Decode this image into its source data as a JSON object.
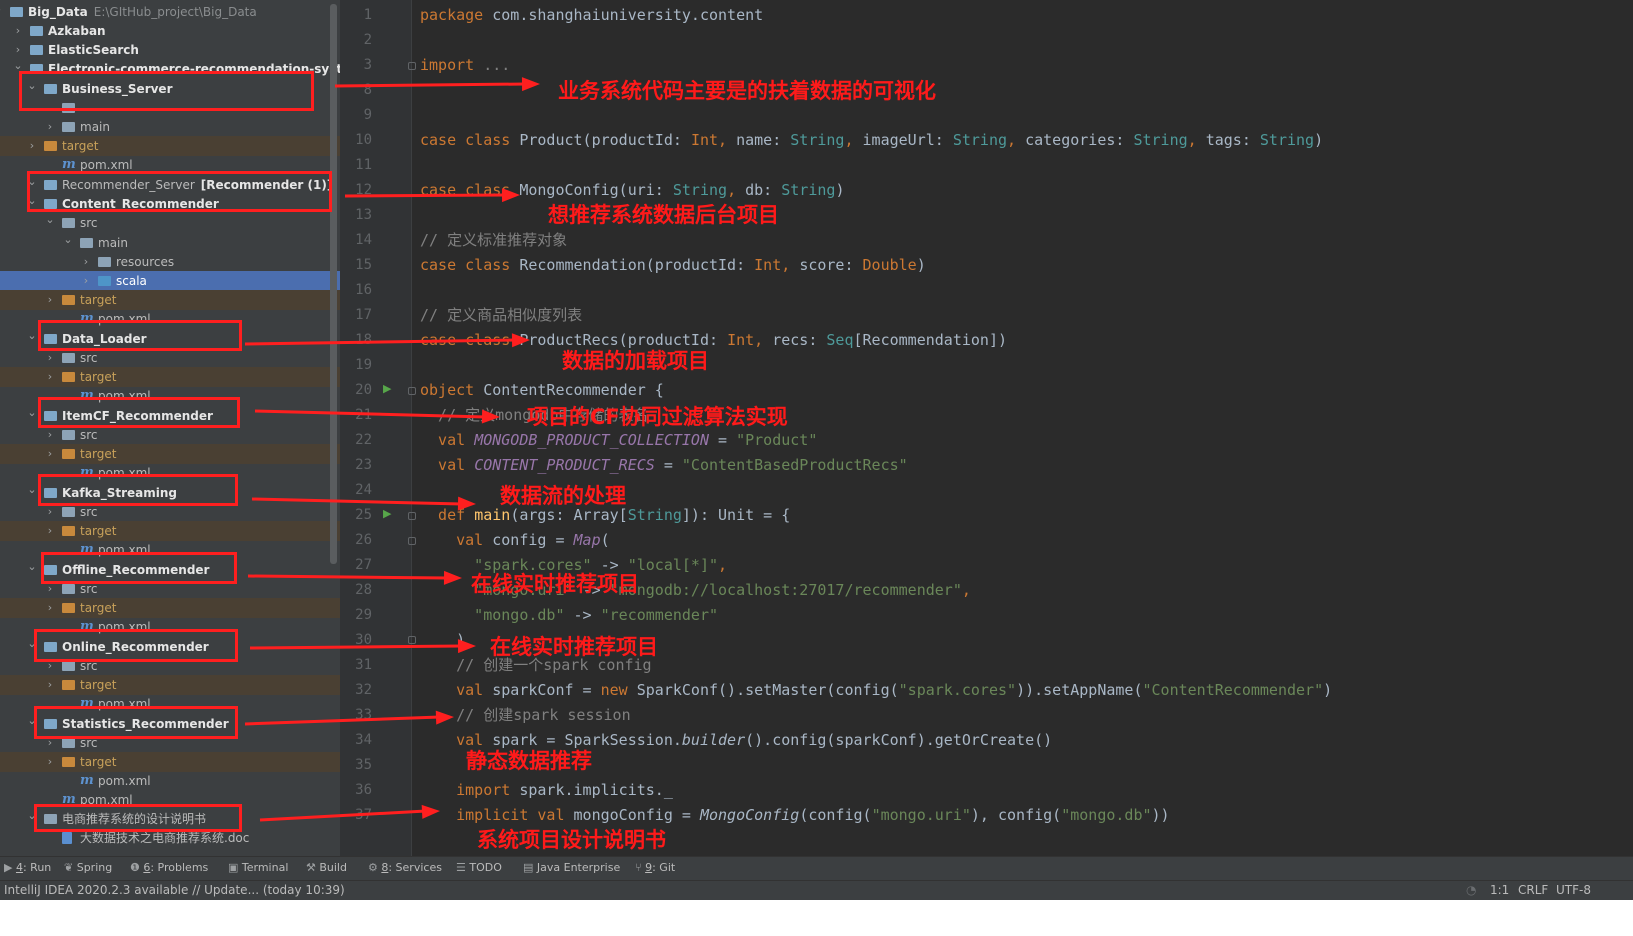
{
  "project_tree": {
    "rows": [
      {
        "label": "Big_Data",
        "path": "E:\\GItHub_project\\Big_Data",
        "bold": true,
        "chev": "v",
        "icon": "mod"
      },
      {
        "label": "Azkaban",
        "bold": true,
        "chev": ">",
        "icon": "mod"
      },
      {
        "label": "ElasticSearch",
        "bold": true,
        "chev": ">",
        "icon": "mod"
      },
      {
        "label": "Electronic-commerce-recommendation-system",
        "bold": true,
        "chev": "v",
        "icon": "mod"
      },
      {
        "label": "Business_Server",
        "bold": true,
        "chev": "v",
        "icon": "mod"
      },
      {
        "label": "",
        "chev": "",
        "icon": "fold"
      },
      {
        "label": "main",
        "chev": ">",
        "icon": "fold"
      },
      {
        "label": "target",
        "chev": ">",
        "icon": "ofold",
        "target": true
      },
      {
        "label": "pom.xml",
        "chev": "",
        "icon": "mv"
      },
      {
        "label": "Recommender_Server",
        "path": "[Recommender (1)]",
        "chev": "v",
        "icon": "mod"
      },
      {
        "label": "Content_Recommender",
        "bold": true,
        "chev": "v",
        "icon": "mod"
      },
      {
        "label": "src",
        "chev": "v",
        "icon": "fold"
      },
      {
        "label": "main",
        "chev": "v",
        "icon": "fold"
      },
      {
        "label": "resources",
        "chev": ">",
        "icon": "fold"
      },
      {
        "label": "scala",
        "chev": ">",
        "icon": "bfold",
        "selected": true
      },
      {
        "label": "target",
        "chev": ">",
        "icon": "ofold",
        "target": true
      },
      {
        "label": "pom.xml",
        "chev": "",
        "icon": "mv"
      },
      {
        "label": "Data_Loader",
        "bold": true,
        "chev": "v",
        "icon": "mod"
      },
      {
        "label": "src",
        "chev": ">",
        "icon": "fold"
      },
      {
        "label": "target",
        "chev": ">",
        "icon": "ofold",
        "target": true
      },
      {
        "label": "pom.xml",
        "chev": "",
        "icon": "mv"
      },
      {
        "label": "ItemCF_Recommender",
        "bold": true,
        "chev": "v",
        "icon": "mod"
      },
      {
        "label": "src",
        "chev": ">",
        "icon": "fold"
      },
      {
        "label": "target",
        "chev": ">",
        "icon": "ofold",
        "target": true
      },
      {
        "label": "pom.xml",
        "chev": "",
        "icon": "mv"
      },
      {
        "label": "Kafka_Streaming",
        "bold": true,
        "chev": "v",
        "icon": "mod"
      },
      {
        "label": "src",
        "chev": ">",
        "icon": "fold"
      },
      {
        "label": "target",
        "chev": ">",
        "icon": "ofold",
        "target": true
      },
      {
        "label": "pom.xml",
        "chev": "",
        "icon": "mv"
      },
      {
        "label": "Offline_Recommender",
        "bold": true,
        "chev": "v",
        "icon": "mod"
      },
      {
        "label": "src",
        "chev": ">",
        "icon": "fold"
      },
      {
        "label": "target",
        "chev": ">",
        "icon": "ofold",
        "target": true
      },
      {
        "label": "pom.xml",
        "chev": "",
        "icon": "mv"
      },
      {
        "label": "Online_Recommender",
        "bold": true,
        "chev": "v",
        "icon": "mod"
      },
      {
        "label": "src",
        "chev": ">",
        "icon": "fold"
      },
      {
        "label": "target",
        "chev": ">",
        "icon": "ofold",
        "target": true
      },
      {
        "label": "pom.xml",
        "chev": "",
        "icon": "mv"
      },
      {
        "label": "Statistics_Recommender",
        "bold": true,
        "chev": "v",
        "icon": "mod"
      },
      {
        "label": "src",
        "chev": ">",
        "icon": "fold"
      },
      {
        "label": "target",
        "chev": ">",
        "icon": "ofold",
        "target": true
      },
      {
        "label": "pom.xml",
        "chev": "",
        "icon": "mv"
      },
      {
        "label": "pom.xml",
        "chev": "",
        "icon": "mv"
      },
      {
        "label": "电商推荐系统的设计说明书",
        "chev": "v",
        "icon": "fold"
      },
      {
        "label": "大数据技术之电商推荐系统.doc",
        "chev": "",
        "icon": "doc"
      }
    ]
  },
  "editor": {
    "lines": [
      {
        "n": "1",
        "segs": [
          [
            "kw",
            "package "
          ],
          [
            "",
            "com.shanghaiuniversity.content"
          ]
        ]
      },
      {
        "n": "2",
        "segs": []
      },
      {
        "n": "3",
        "segs": [
          [
            "kw",
            "import "
          ],
          [
            "cm",
            "..."
          ]
        ]
      },
      {
        "n": "8",
        "segs": []
      },
      {
        "n": "9",
        "segs": []
      },
      {
        "n": "10",
        "segs": [
          [
            "kw",
            "case class "
          ],
          [
            "",
            "Product(productId: "
          ],
          [
            "kw",
            "Int, "
          ],
          [
            "",
            "name: "
          ],
          [
            "ty",
            "String"
          ],
          [
            "kw",
            ", "
          ],
          [
            "",
            "imageUrl: "
          ],
          [
            "ty",
            "String"
          ],
          [
            "kw",
            ", "
          ],
          [
            "",
            "categories: "
          ],
          [
            "ty",
            "String"
          ],
          [
            "kw",
            ", "
          ],
          [
            "",
            "tags: "
          ],
          [
            "ty",
            "String"
          ],
          [
            "",
            ")"
          ]
        ]
      },
      {
        "n": "11",
        "segs": []
      },
      {
        "n": "12",
        "segs": [
          [
            "kw",
            "case class "
          ],
          [
            "",
            "MongoConfig(uri: "
          ],
          [
            "ty",
            "String"
          ],
          [
            "kw",
            ", "
          ],
          [
            "",
            "db: "
          ],
          [
            "ty",
            "String"
          ],
          [
            "",
            ")"
          ]
        ]
      },
      {
        "n": "13",
        "segs": []
      },
      {
        "n": "14",
        "segs": [
          [
            "cm",
            "// 定义标准推荐对象"
          ]
        ]
      },
      {
        "n": "15",
        "segs": [
          [
            "kw",
            "case class "
          ],
          [
            "",
            "Recommendation(productId: "
          ],
          [
            "kw",
            "Int, "
          ],
          [
            "",
            "score: "
          ],
          [
            "kw",
            "Double"
          ],
          [
            "",
            ")"
          ]
        ]
      },
      {
        "n": "16",
        "segs": []
      },
      {
        "n": "17",
        "segs": [
          [
            "cm",
            "// 定义商品相似度列表"
          ]
        ]
      },
      {
        "n": "18",
        "segs": [
          [
            "kw",
            "case class "
          ],
          [
            "",
            "ProductRecs(productId: "
          ],
          [
            "kw",
            "Int, "
          ],
          [
            "",
            "recs: "
          ],
          [
            "ty",
            "Seq"
          ],
          [
            "",
            "[Recommendation])"
          ]
        ]
      },
      {
        "n": "19",
        "segs": []
      },
      {
        "n": "20",
        "segs": [
          [
            "kw",
            "object "
          ],
          [
            "",
            "ContentRecommender {"
          ]
        ]
      },
      {
        "n": "21",
        "segs": [
          [
            "cm",
            "  // 定义mongodb中存储的表名"
          ]
        ]
      },
      {
        "n": "22",
        "segs": [
          [
            "kw",
            "  val "
          ],
          [
            "it",
            "MONGODB_PRODUCT_COLLECTION"
          ],
          [
            "",
            " = "
          ],
          [
            "st",
            "\"Product\""
          ]
        ]
      },
      {
        "n": "23",
        "segs": [
          [
            "kw",
            "  val "
          ],
          [
            "it",
            "CONTENT_PRODUCT_RECS"
          ],
          [
            "",
            " = "
          ],
          [
            "st",
            "\"ContentBasedProductRecs\""
          ]
        ]
      },
      {
        "n": "24",
        "segs": []
      },
      {
        "n": "25",
        "segs": [
          [
            "kw",
            "  def "
          ],
          [
            "fn",
            "main"
          ],
          [
            "",
            "(args: Array["
          ],
          [
            "ty",
            "String"
          ],
          [
            "",
            "]): Unit = {"
          ]
        ]
      },
      {
        "n": "26",
        "segs": [
          [
            "kw",
            "    val "
          ],
          [
            "",
            "config = "
          ],
          [
            "it",
            "Map"
          ],
          [
            "",
            "("
          ]
        ]
      },
      {
        "n": "27",
        "segs": [
          [
            "st",
            "      \"spark.cores\""
          ],
          [
            "",
            " -> "
          ],
          [
            "st",
            "\"local[*]\""
          ],
          [
            "kw",
            ","
          ]
        ]
      },
      {
        "n": "28",
        "segs": [
          [
            "st",
            "      \"mongo.uri\""
          ],
          [
            "",
            " -> "
          ],
          [
            "st",
            "\"mongodb://localhost:27017/recommender\""
          ],
          [
            "kw",
            ","
          ]
        ]
      },
      {
        "n": "29",
        "segs": [
          [
            "st",
            "      \"mongo.db\""
          ],
          [
            "",
            " -> "
          ],
          [
            "st",
            "\"recommender\""
          ]
        ]
      },
      {
        "n": "30",
        "segs": [
          [
            "",
            "    )"
          ]
        ]
      },
      {
        "n": "31",
        "segs": [
          [
            "cm",
            "    // 创建一个spark config"
          ]
        ]
      },
      {
        "n": "32",
        "segs": [
          [
            "kw",
            "    val "
          ],
          [
            "",
            "sparkConf = "
          ],
          [
            "kw",
            "new "
          ],
          [
            "",
            "SparkConf().setMaster(config("
          ],
          [
            "st",
            "\"spark.cores\""
          ],
          [
            "",
            ")).setAppName("
          ],
          [
            "st",
            "\"ContentRecommender\""
          ],
          [
            "",
            ")"
          ]
        ]
      },
      {
        "n": "33",
        "segs": [
          [
            "cm",
            "    // 创建spark session"
          ]
        ]
      },
      {
        "n": "34",
        "segs": [
          [
            "kw",
            "    val "
          ],
          [
            "",
            "spark = SparkSession."
          ],
          [
            "itf",
            "builder"
          ],
          [
            "",
            "().config(sparkConf).getOrCreate()"
          ]
        ]
      },
      {
        "n": "35",
        "segs": []
      },
      {
        "n": "36",
        "segs": [
          [
            "kw",
            "    import "
          ],
          [
            "",
            "spark.implicits._"
          ]
        ]
      },
      {
        "n": "37",
        "segs": [
          [
            "kw",
            "    implicit val "
          ],
          [
            "",
            "mongoConfig = "
          ],
          [
            "itf",
            "MongoConfig"
          ],
          [
            "",
            "(config("
          ],
          [
            "st",
            "\"mongo.uri\""
          ],
          [
            "",
            "), config("
          ],
          [
            "st",
            "\"mongo.db\""
          ],
          [
            "",
            "))"
          ]
        ]
      }
    ]
  },
  "annotations": [
    "业务系统代码主要是的扶着数据的可视化",
    "想推荐系统数据后台项目",
    "数据的加载项目",
    "项目的CF协同过滤算法实现",
    "数据流的处理",
    "在线实时推荐项目",
    "在线实时推荐项目",
    "静态数据推荐",
    "系统项目设计说明书"
  ],
  "bottom_tabs": [
    {
      "num": "4",
      "label": ": Run",
      "icon": "run-icon"
    },
    {
      "num": "",
      "label": "Spring",
      "icon": "spring-icon"
    },
    {
      "num": "6",
      "label": ": Problems",
      "icon": "problems-icon"
    },
    {
      "num": "",
      "label": "Terminal",
      "icon": "terminal-icon"
    },
    {
      "num": "",
      "label": "Build",
      "icon": "build-icon"
    },
    {
      "num": "8",
      "label": ": Services",
      "icon": "services-icon"
    },
    {
      "num": "",
      "label": "TODO",
      "icon": "todo-icon"
    },
    {
      "num": "",
      "label": "Java Enterprise",
      "icon": "java-enterprise-icon"
    },
    {
      "num": "9",
      "label": ": Git",
      "icon": "git-icon"
    }
  ],
  "status_bar": {
    "message": "IntelliJ IDEA 2020.2.3 available // Update... (today 10:39)",
    "position": "1:1",
    "line_sep": "CRLF",
    "encoding": "UTF-8"
  },
  "colors": {
    "annotation_red": "#ff1f1f",
    "editor_bg": "#2b2b2b",
    "sidebar_bg": "#3c3f41",
    "selection": "#4b6eaf"
  }
}
